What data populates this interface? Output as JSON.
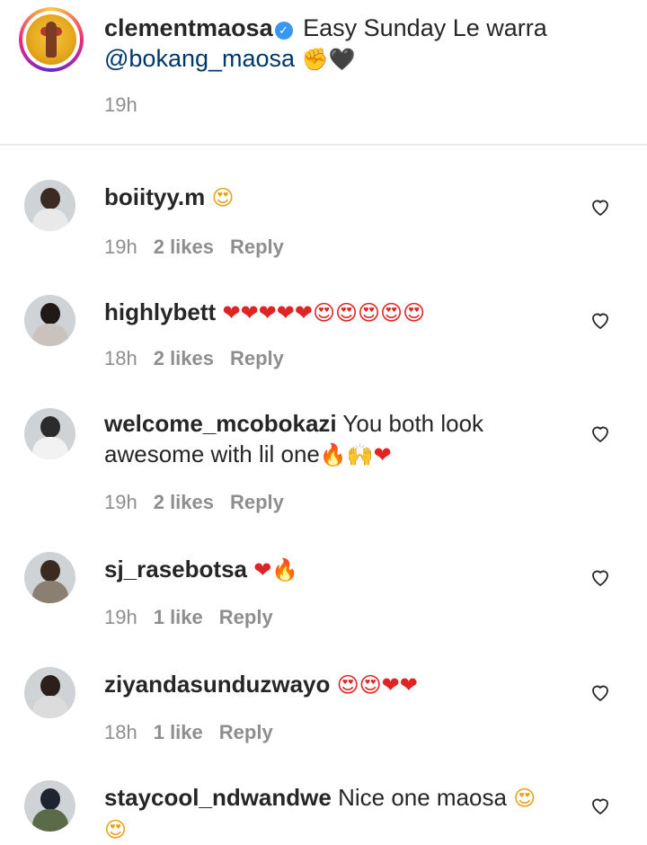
{
  "caption": {
    "username": "clementmaosa",
    "verified_icon": "✓",
    "text": "Easy Sunday Le warra",
    "mention": "@bokang_maosa",
    "emojis": "✊🖤",
    "time": "19h"
  },
  "comments": [
    {
      "username": "boiityy.m",
      "text": "",
      "emojis": "😍",
      "time": "19h",
      "likes": "2 likes",
      "reply": "Reply"
    },
    {
      "username": "highlybett",
      "text": "",
      "emojis": "❤❤❤❤❤😍😍😍😍😍",
      "time": "18h",
      "likes": "2 likes",
      "reply": "Reply"
    },
    {
      "username": "welcome_mcobokazi",
      "text": "You both look awesome with lil one",
      "emojis": "🔥🙌❤",
      "time": "19h",
      "likes": "2 likes",
      "reply": "Reply"
    },
    {
      "username": "sj_rasebotsa",
      "text": "",
      "emojis": "❤🔥",
      "time": "19h",
      "likes": "1 like",
      "reply": "Reply"
    },
    {
      "username": "ziyandasunduzwayo",
      "text": "",
      "emojis": "😍😍❤❤",
      "time": "18h",
      "likes": "1 like",
      "reply": "Reply"
    },
    {
      "username": "staycool_ndwandwe",
      "text": "Nice one maosa",
      "emojis": "😍😍",
      "time": "",
      "likes": "",
      "reply": ""
    }
  ],
  "icons": {
    "like": "heart-outline-icon",
    "verified": "verified-badge-icon"
  },
  "colors": {
    "username": "#262626",
    "meta": "#8e8e8e",
    "mention": "#00376b",
    "verified": "#3897f0"
  }
}
